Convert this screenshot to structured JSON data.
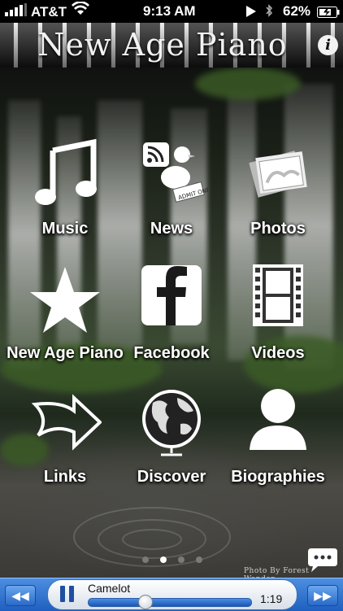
{
  "status_bar": {
    "carrier": "AT&T",
    "time": "9:13 AM",
    "battery": "62%"
  },
  "header": {
    "title": "New Age Piano",
    "info_icon": "info-icon"
  },
  "grid": [
    {
      "label": "Music",
      "icon": "music-note-icon"
    },
    {
      "label": "News",
      "icon": "news-icon"
    },
    {
      "label": "Photos",
      "icon": "photos-icon"
    },
    {
      "label": "New Age Piano",
      "icon": "star-icon"
    },
    {
      "label": "Facebook",
      "icon": "facebook-icon"
    },
    {
      "label": "Videos",
      "icon": "film-icon"
    },
    {
      "label": "Links",
      "icon": "arrow-icon"
    },
    {
      "label": "Discover",
      "icon": "globe-icon"
    },
    {
      "label": "Biographies",
      "icon": "person-icon"
    }
  ],
  "page_indicator": {
    "pages": 4,
    "current": 2
  },
  "photo_credit": "Photo By Forest Wander",
  "player": {
    "song": "Camelot",
    "time": "1:19",
    "progress": 0.35,
    "accent": "#1f5fbf"
  }
}
